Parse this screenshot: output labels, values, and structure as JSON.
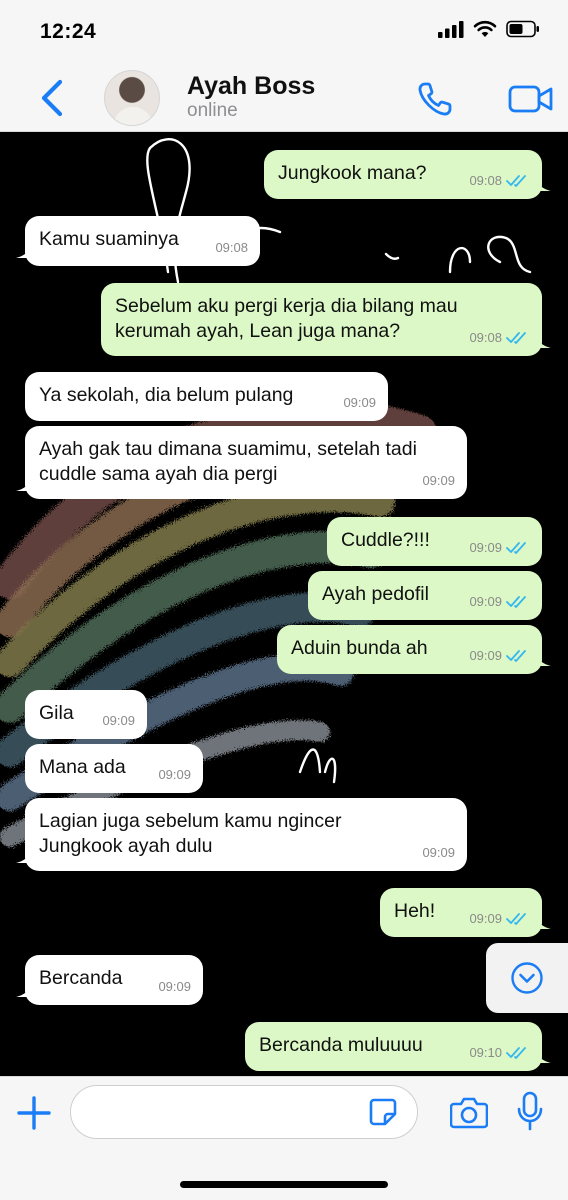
{
  "status_bar": {
    "time": "12:24"
  },
  "header": {
    "contact_name": "Ayah Boss",
    "contact_status": "online",
    "icons": {
      "back": "chevron-left-icon",
      "call": "phone-icon",
      "video": "video-camera-icon"
    }
  },
  "colors": {
    "accent": "#1a7df5",
    "outgoing_bubble": "#dcf8c6",
    "incoming_bubble": "#ffffff",
    "read_tick": "#34b7f1"
  },
  "messages": [
    {
      "dir": "out",
      "text": "Jungkook mana?",
      "time": "09:08"
    },
    {
      "dir": "in",
      "text": "Kamu suaminya",
      "time": "09:08"
    },
    {
      "dir": "out",
      "text": "Sebelum aku pergi kerja dia bilang mau kerumah ayah, Lean juga mana?",
      "time": "09:08"
    },
    {
      "dir": "in",
      "text": "Ya sekolah, dia belum pulang",
      "time": "09:09"
    },
    {
      "dir": "in",
      "text": "Ayah gak tau dimana suamimu, setelah tadi cuddle sama ayah dia pergi",
      "time": "09:09"
    },
    {
      "dir": "out",
      "text": "Cuddle?!!!",
      "time": "09:09"
    },
    {
      "dir": "out",
      "text": "Ayah pedofil",
      "time": "09:09"
    },
    {
      "dir": "out",
      "text": "Aduin bunda ah",
      "time": "09:09"
    },
    {
      "dir": "in",
      "text": "Gila",
      "time": "09:09"
    },
    {
      "dir": "in",
      "text": "Mana ada",
      "time": "09:09"
    },
    {
      "dir": "in",
      "text": "Lagian juga sebelum kamu ngincer Jungkook ayah dulu",
      "time": "09:09"
    },
    {
      "dir": "out",
      "text": "Heh!",
      "time": "09:09"
    },
    {
      "dir": "in",
      "text": "Bercanda",
      "time": "09:09"
    },
    {
      "dir": "out",
      "text": "Bercanda muluuuu",
      "time": "09:10"
    }
  ],
  "input": {
    "placeholder": "",
    "icons": {
      "attach": "plus-icon",
      "sticker": "sticker-icon",
      "camera": "camera-icon",
      "mic": "microphone-icon",
      "scroll": "chevron-down-circle-icon"
    }
  }
}
